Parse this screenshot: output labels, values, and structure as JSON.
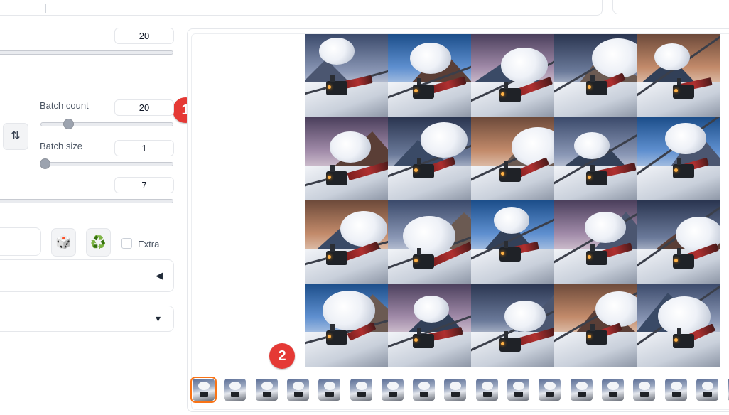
{
  "top_row_slider": {
    "value": "20"
  },
  "batch_count": {
    "label": "Batch count",
    "value": "20",
    "fraction": 0.19
  },
  "batch_size": {
    "label": "Batch size",
    "value": "1",
    "fraction": 0.0
  },
  "cfg_row": {
    "value": "7"
  },
  "swap_icon": "⇅",
  "dice_icon": "🎲",
  "recycle_icon": "♻️",
  "extra": {
    "label": "Extra",
    "checked": false
  },
  "accordion": {
    "arrow": "◀"
  },
  "dropdown": {
    "arrow": "▾"
  },
  "badges": {
    "one": "1",
    "two": "2"
  },
  "gallery": {
    "grid_rows": 4,
    "grid_cols": 5,
    "thumbnail_count": 18,
    "selected_thumbnail": 0
  },
  "colors": {
    "accent": "#f97316",
    "badge": "#e53935"
  }
}
